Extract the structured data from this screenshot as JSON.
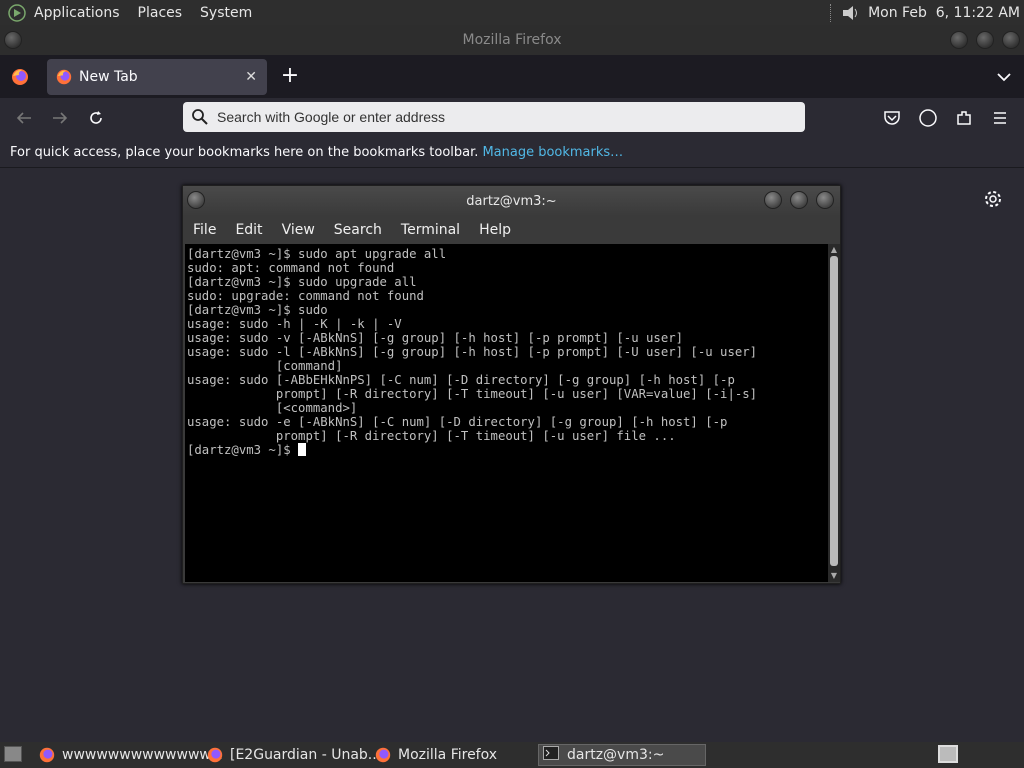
{
  "top_panel": {
    "menus": [
      "Applications",
      "Places",
      "System"
    ],
    "clock": "Mon Feb  6, 11:22 AM"
  },
  "window": {
    "title": "Mozilla Firefox"
  },
  "firefox": {
    "tab": {
      "label": "New Tab",
      "close": "✕"
    },
    "new_tab_symbol": "+",
    "urlbar_placeholder": "Search with Google or enter address",
    "bookmarks_text": "For quick access, place your bookmarks here on the bookmarks toolbar.",
    "bookmarks_link": "Manage bookmarks…"
  },
  "terminal": {
    "title": "dartz@vm3:~",
    "menus": [
      "File",
      "Edit",
      "View",
      "Search",
      "Terminal",
      "Help"
    ],
    "lines": [
      "[dartz@vm3 ~]$ sudo apt upgrade all",
      "sudo: apt: command not found",
      "[dartz@vm3 ~]$ sudo upgrade all",
      "sudo: upgrade: command not found",
      "[dartz@vm3 ~]$ sudo",
      "usage: sudo -h | -K | -k | -V",
      "usage: sudo -v [-ABkNnS] [-g group] [-h host] [-p prompt] [-u user]",
      "usage: sudo -l [-ABkNnS] [-g group] [-h host] [-p prompt] [-U user] [-u user]",
      "            [command]",
      "usage: sudo [-ABbEHkNnPS] [-C num] [-D directory] [-g group] [-h host] [-p",
      "            prompt] [-R directory] [-T timeout] [-u user] [VAR=value] [-i|-s]",
      "            [<command>]",
      "usage: sudo -e [-ABkNnS] [-C num] [-D directory] [-g group] [-h host] [-p",
      "            prompt] [-R directory] [-T timeout] [-u user] file ..."
    ],
    "prompt": "[dartz@vm3 ~]$ "
  },
  "taskbar": {
    "tasks": [
      {
        "label": "wwwwwwwwwwwww...",
        "icon": "firefox-icon"
      },
      {
        "label": "[E2Guardian - Unab...",
        "icon": "firefox-icon"
      },
      {
        "label": "Mozilla Firefox",
        "icon": "firefox-icon"
      },
      {
        "label": "dartz@vm3:~",
        "icon": "terminal-icon"
      }
    ]
  },
  "colors": {
    "firefox_bg": "#2b2a33",
    "accent_link": "#51b8e6",
    "panel": "#2e2e2e"
  }
}
